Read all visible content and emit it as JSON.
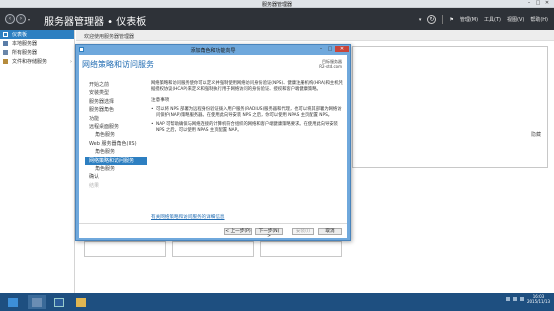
{
  "window": {
    "title": "服务器管理器",
    "controls": [
      "–",
      "□",
      "✕"
    ]
  },
  "header": {
    "title": "服务器管理器 • 仪表板",
    "menus": [
      "管理(M)",
      "工具(T)",
      "视图(V)",
      "帮助(H)"
    ]
  },
  "sidebar": {
    "items": [
      {
        "label": "仪表板",
        "icon": "dashboard-icon"
      },
      {
        "label": "本地服务器",
        "icon": "server-icon"
      },
      {
        "label": "所有服务器",
        "icon": "servers-icon"
      },
      {
        "label": "文件和存储服务",
        "icon": "folder-icon"
      }
    ]
  },
  "main": {
    "welcome": "欢迎使用服务器管理器",
    "hide_label": "隐藏"
  },
  "dialog": {
    "title": "添加角色和功能向导",
    "heading": "网络策略和访问服务",
    "target_label": "目标服务器",
    "target_server": "R2-std.com",
    "steps": [
      {
        "label": "开始之前",
        "state": "normal"
      },
      {
        "label": "安装类型",
        "state": "normal"
      },
      {
        "label": "服务器选择",
        "state": "normal"
      },
      {
        "label": "服务器角色",
        "state": "normal"
      },
      {
        "label": "功能",
        "state": "normal"
      },
      {
        "label": "远程桌面服务",
        "state": "normal"
      },
      {
        "label": "角色服务",
        "state": "sub"
      },
      {
        "label": "Web 服务器角色(IIS)",
        "state": "normal"
      },
      {
        "label": "角色服务",
        "state": "sub"
      },
      {
        "label": "网络策略和访问服务",
        "state": "active"
      },
      {
        "label": "角色服务",
        "state": "sub"
      },
      {
        "label": "确认",
        "state": "normal"
      },
      {
        "label": "结果",
        "state": "disabled"
      }
    ],
    "intro": "网络策略和访问服务使你可以定义并强制使用网络访问身份验证(NPS)、健康注册机构(HRA)和主机凭据授权协议(HCAP)来定义和强制执行用于网络访问的身份验证、授权和客户端健康策略。",
    "notes_title": "注意事项",
    "notes": [
      "可以将 NPS 部署为远程身份验证拨入用户服务(RADIUS)服务器和代理，也可以将其部署为网络访问保护(NAP)策略服务器。在使用此向导安装 NPS 之后，你可以使用 NPAS 主页配置 NPS。",
      "NAP 可帮助确保与网络连接的计算机符合组织的网络和客户端健康策略要求。在使用此向导安装 NPS 之后，可以使用 NPAS 主页配置 NAP。"
    ],
    "more_link": "有关网络策略和访问服务的详细信息",
    "buttons": {
      "prev": "< 上一步(P)",
      "next": "下一步(N) >",
      "install": "安装(I)",
      "cancel": "取消"
    }
  },
  "taskbar": {
    "time": "16:03",
    "date": "2015/11/13"
  }
}
